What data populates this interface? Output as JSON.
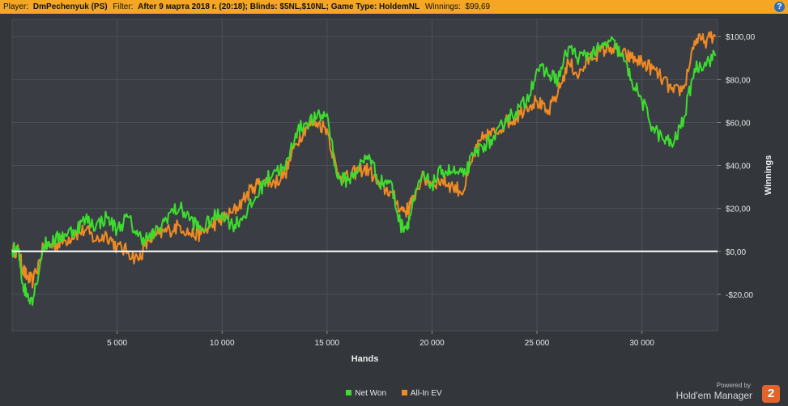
{
  "header": {
    "player_label": "Player:",
    "player": "DmPechenyuk (PS)",
    "filter_label": "Filter:",
    "filter": "After 9 марта 2018 г. (20:18); Blinds: $5NL,$10NL; Game Type: HoldemNL",
    "winnings_label": "Winnings:",
    "winnings": "$99,69",
    "help_icon": "?"
  },
  "chart_data": {
    "type": "line",
    "xlabel": "Hands",
    "ylabel": "Winnings",
    "xlim": [
      0,
      33600
    ],
    "ylim": [
      -37,
      108
    ],
    "x_ticks": [
      5000,
      10000,
      15000,
      20000,
      25000,
      30000
    ],
    "x_tick_labels": [
      "5 000",
      "10 000",
      "15 000",
      "20 000",
      "25 000",
      "30 000"
    ],
    "y_ticks": [
      -20,
      0,
      20,
      40,
      60,
      80,
      100
    ],
    "y_tick_labels": [
      "-$20,00",
      "$0,00",
      "$20,00",
      "$40,00",
      "$60,00",
      "$80,00",
      "$100,00"
    ],
    "grid": true,
    "legend_position": "bottom",
    "series": [
      {
        "name": "Net Won",
        "color": "#3ddc2f",
        "x": [
          0,
          300,
          500,
          700,
          1000,
          1500,
          2000,
          2500,
          3000,
          3500,
          4000,
          4500,
          5000,
          5500,
          6000,
          6500,
          7000,
          7500,
          8000,
          8500,
          9000,
          9500,
          10000,
          10500,
          11000,
          11500,
          12000,
          12500,
          13000,
          13500,
          14000,
          14500,
          15000,
          15500,
          16000,
          16500,
          17000,
          17500,
          18000,
          18500,
          18800,
          19000,
          19500,
          20000,
          20500,
          21000,
          21500,
          22000,
          22500,
          23000,
          23500,
          24000,
          24500,
          25000,
          25500,
          26000,
          26500,
          27000,
          27500,
          28000,
          28500,
          29000,
          29500,
          30000,
          30500,
          31000,
          31500,
          32000,
          32500,
          33000,
          33500
        ],
        "values": [
          1,
          0,
          -15,
          -20,
          -22,
          3,
          5,
          8,
          10,
          15,
          12,
          16,
          10,
          16,
          7,
          6,
          10,
          18,
          20,
          15,
          10,
          15,
          18,
          12,
          16,
          23,
          32,
          38,
          38,
          55,
          60,
          62,
          64,
          34,
          33,
          39,
          45,
          32,
          33,
          12,
          12,
          18,
          35,
          31,
          38,
          37,
          35,
          45,
          50,
          52,
          62,
          65,
          70,
          85,
          83,
          80,
          95,
          90,
          92,
          94,
          98,
          92,
          80,
          70,
          58,
          52,
          50,
          62,
          85,
          88,
          91
        ]
      },
      {
        "name": "All-In EV",
        "color": "#f08a24",
        "x": [
          0,
          300,
          500,
          700,
          1000,
          1500,
          2000,
          2500,
          3000,
          3500,
          4000,
          4500,
          5000,
          5500,
          6000,
          6500,
          7000,
          7500,
          8000,
          8500,
          9000,
          9500,
          10000,
          10500,
          11000,
          11500,
          12000,
          12500,
          13000,
          13500,
          14000,
          14500,
          15000,
          15500,
          16000,
          16500,
          17000,
          17500,
          18000,
          18500,
          18800,
          19000,
          19500,
          20000,
          20500,
          21000,
          21500,
          22000,
          22500,
          23000,
          23500,
          24000,
          24500,
          25000,
          25500,
          26000,
          26500,
          27000,
          27500,
          28000,
          28500,
          29000,
          29500,
          30000,
          30500,
          31000,
          31500,
          32000,
          32500,
          33000,
          33500
        ],
        "values": [
          1,
          0,
          -8,
          -12,
          -14,
          2,
          3,
          5,
          8,
          10,
          5,
          8,
          2,
          0,
          -4,
          5,
          8,
          10,
          12,
          8,
          8,
          12,
          15,
          18,
          24,
          30,
          33,
          32,
          36,
          50,
          58,
          60,
          57,
          36,
          34,
          38,
          38,
          30,
          28,
          20,
          19,
          22,
          34,
          32,
          33,
          30,
          28,
          45,
          54,
          55,
          60,
          62,
          68,
          70,
          64,
          74,
          88,
          82,
          90,
          93,
          95,
          92,
          90,
          88,
          85,
          80,
          74,
          76,
          98,
          98,
          100
        ]
      }
    ]
  },
  "legend": {
    "items": [
      {
        "label": "Net Won",
        "color": "#3ddc2f"
      },
      {
        "label": "All-In EV",
        "color": "#f08a24"
      }
    ]
  },
  "brand": {
    "powered_by": "Powered by",
    "name": "Hold'em Manager",
    "badge": "2"
  }
}
